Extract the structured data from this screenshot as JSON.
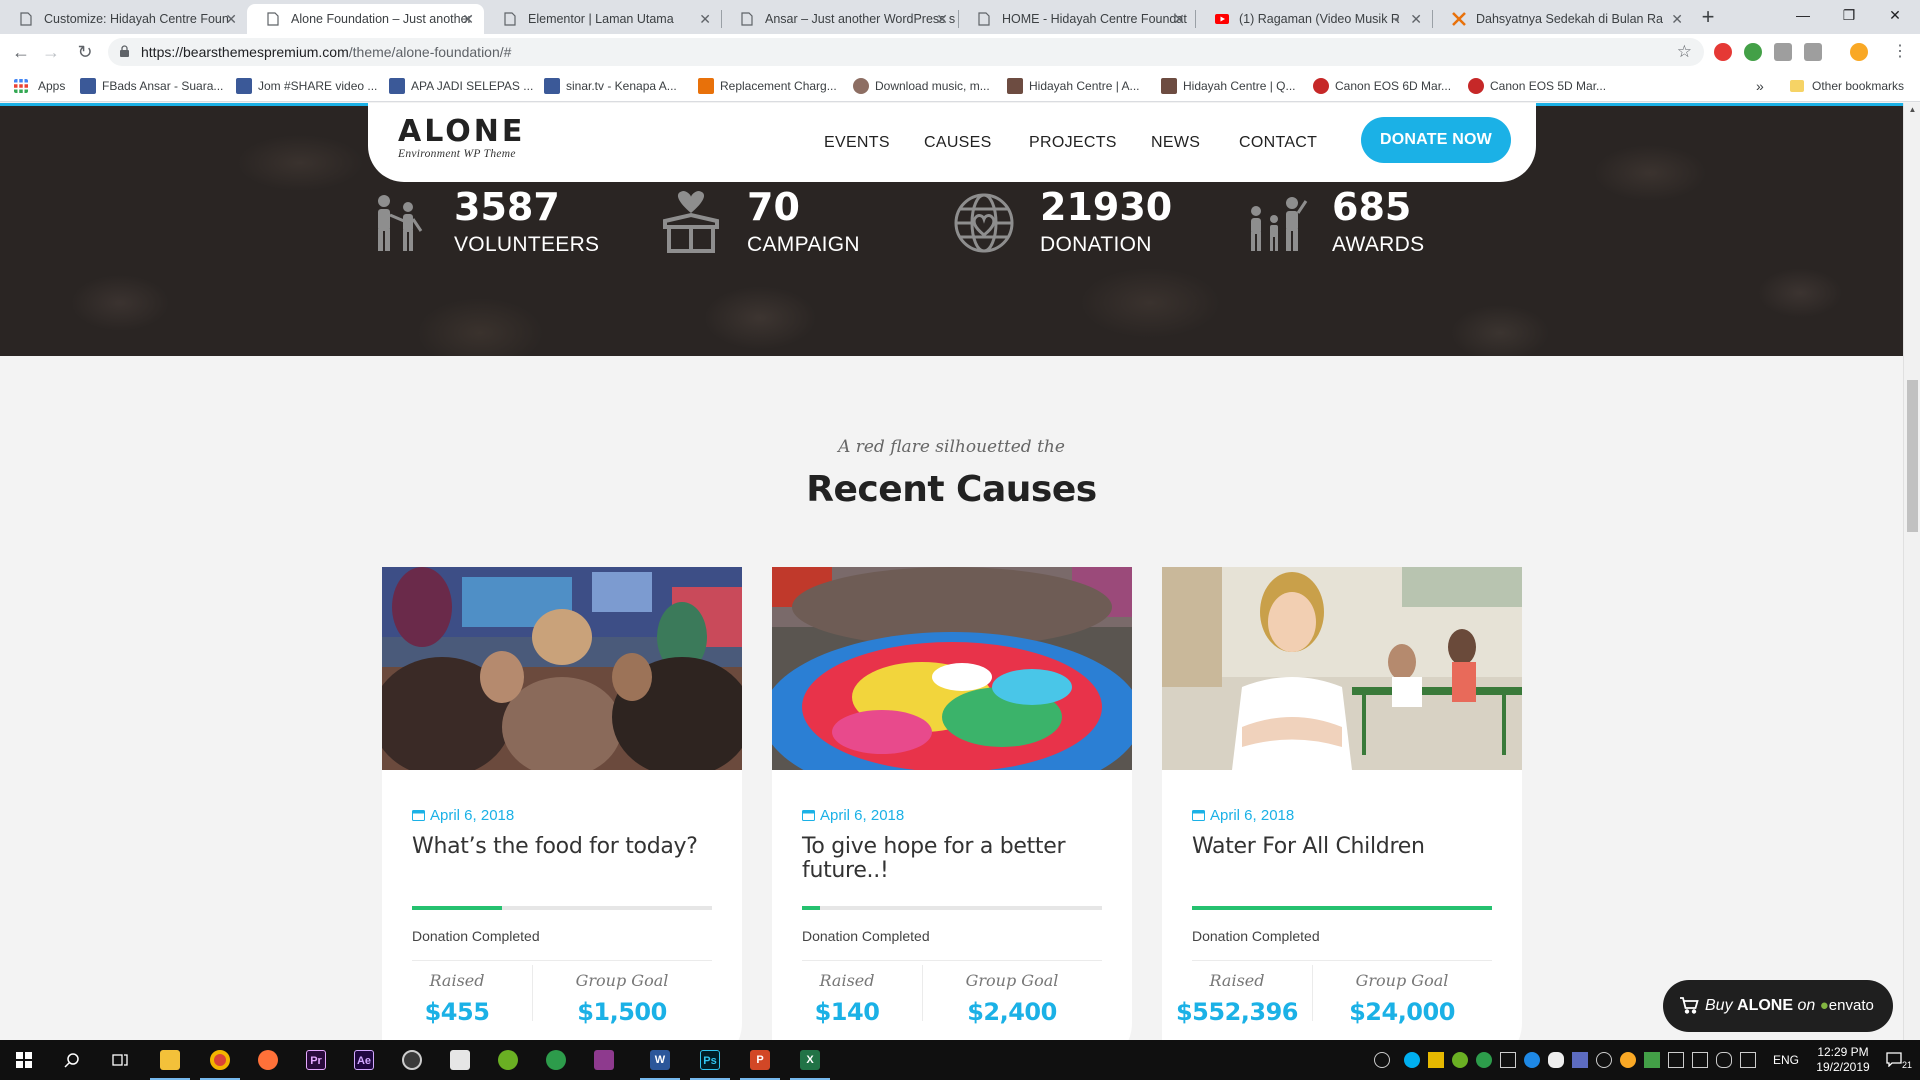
{
  "browser": {
    "tabs": [
      {
        "title": "Customize: Hidayah Centre Foun",
        "active": false
      },
      {
        "title": "Alone Foundation – Just another",
        "active": true
      },
      {
        "title": "Elementor | Laman Utama",
        "active": false
      },
      {
        "title": "Ansar – Just another WordPress s",
        "active": false
      },
      {
        "title": "HOME - Hidayah Centre Foundat",
        "active": false
      },
      {
        "title": "(1) Ragaman (Video Musik R",
        "active": false
      },
      {
        "title": "Dahsyatnya Sedekah di Bulan Ra",
        "active": false
      }
    ],
    "url_host": "https://bearsthemespremium.com",
    "url_path": "/theme/alone-foundation/#",
    "bookmarks": [
      {
        "label": "Apps",
        "icon": "apps-grid-icon",
        "color": "#4285f4"
      },
      {
        "label": "FBads Ansar - Suara...",
        "icon": "facebook-icon",
        "color": "#3b5998"
      },
      {
        "label": "Jom #SHARE video ...",
        "icon": "facebook-icon",
        "color": "#3b5998"
      },
      {
        "label": "APA JADI SELEPAS ...",
        "icon": "facebook-icon",
        "color": "#3b5998"
      },
      {
        "label": "sinar.tv - Kenapa A...",
        "icon": "facebook-icon",
        "color": "#3b5998"
      },
      {
        "label": "Replacement Charg...",
        "icon": "store-icon",
        "color": "#e8710a"
      },
      {
        "label": "Download music, m...",
        "icon": "music-icon",
        "color": "#8d6e63"
      },
      {
        "label": "Hidayah Centre | A...",
        "icon": "site-icon",
        "color": "#6d4c41"
      },
      {
        "label": "Hidayah Centre | Q...",
        "icon": "site-icon",
        "color": "#6d4c41"
      },
      {
        "label": "Canon EOS 6D Mar...",
        "icon": "bug-icon",
        "color": "#c62828"
      },
      {
        "label": "Canon EOS 5D Mar...",
        "icon": "bug-icon",
        "color": "#c62828"
      }
    ],
    "other_bookmarks": "Other bookmarks"
  },
  "site": {
    "logo": "ALONE",
    "logo_sub": "Environment WP Theme",
    "nav": [
      "EVENTS",
      "CAUSES",
      "PROJECTS",
      "NEWS",
      "CONTACT"
    ],
    "donate": "DONATE NOW",
    "accent": "#1bb1e6",
    "progress_color": "#25c16f",
    "stats": [
      {
        "number": "3587",
        "label": "VOLUNTEERS",
        "icon": "volunteers-icon"
      },
      {
        "number": "70",
        "label": "CAMPAIGN",
        "icon": "heart-box-icon"
      },
      {
        "number": "21930",
        "label": "DONATION",
        "icon": "globe-heart-icon"
      },
      {
        "number": "685",
        "label": "AWARDS",
        "icon": "family-icon"
      }
    ],
    "causes_subtitle": "A red flare silhouetted the",
    "causes_title": "Recent Causes",
    "causes": [
      {
        "date": "April 6, 2018",
        "title": "What’s the food for today?",
        "progress": 0.3,
        "status": "Donation Completed",
        "raised_label": "Raised",
        "raised": "$455",
        "goal_label": "Group Goal",
        "goal": "$1,500"
      },
      {
        "date": "April 6, 2018",
        "title": "To give hope for a better future..!",
        "progress": 0.06,
        "status": "Donation Completed",
        "raised_label": "Raised",
        "raised": "$140",
        "goal_label": "Group Goal",
        "goal": "$2,400"
      },
      {
        "date": "April 6, 2018",
        "title": "Water For All Children",
        "progress": 1.0,
        "status": "Donation Completed",
        "raised_label": "Raised",
        "raised": "$552,396",
        "goal_label": "Group Goal",
        "goal": "$24,000"
      }
    ],
    "badge": {
      "buy": "Buy",
      "product": "ALONE",
      "on": "on",
      "market": "envato"
    }
  },
  "taskbar": {
    "apps": [
      {
        "name": "file-explorer",
        "label": "",
        "color": "#f3c13a"
      },
      {
        "name": "chrome",
        "label": "",
        "color": "#db4437"
      },
      {
        "name": "firefox",
        "label": "",
        "color": "#ff7139"
      },
      {
        "name": "premiere",
        "label": "Pr",
        "color": "#2a0a3c"
      },
      {
        "name": "after-effects",
        "label": "Ae",
        "color": "#1f0740"
      },
      {
        "name": "obs",
        "label": "",
        "color": "#3a3a3a"
      },
      {
        "name": "mail",
        "label": "",
        "color": "#e6e6e6"
      },
      {
        "name": "green-app",
        "label": "",
        "color": "#6ab023"
      },
      {
        "name": "globe-app",
        "label": "",
        "color": "#2d9c4b"
      },
      {
        "name": "winrar",
        "label": "",
        "color": "#8e3a8e"
      },
      {
        "name": "word",
        "label": "W",
        "color": "#2b579a"
      },
      {
        "name": "photoshop",
        "label": "Ps",
        "color": "#001d26"
      },
      {
        "name": "powerpoint",
        "label": "P",
        "color": "#d24726"
      },
      {
        "name": "excel",
        "label": "X",
        "color": "#217346"
      }
    ],
    "lang": "ENG",
    "time": "12:29 PM",
    "date": "19/2/2019",
    "notifications": "21"
  }
}
